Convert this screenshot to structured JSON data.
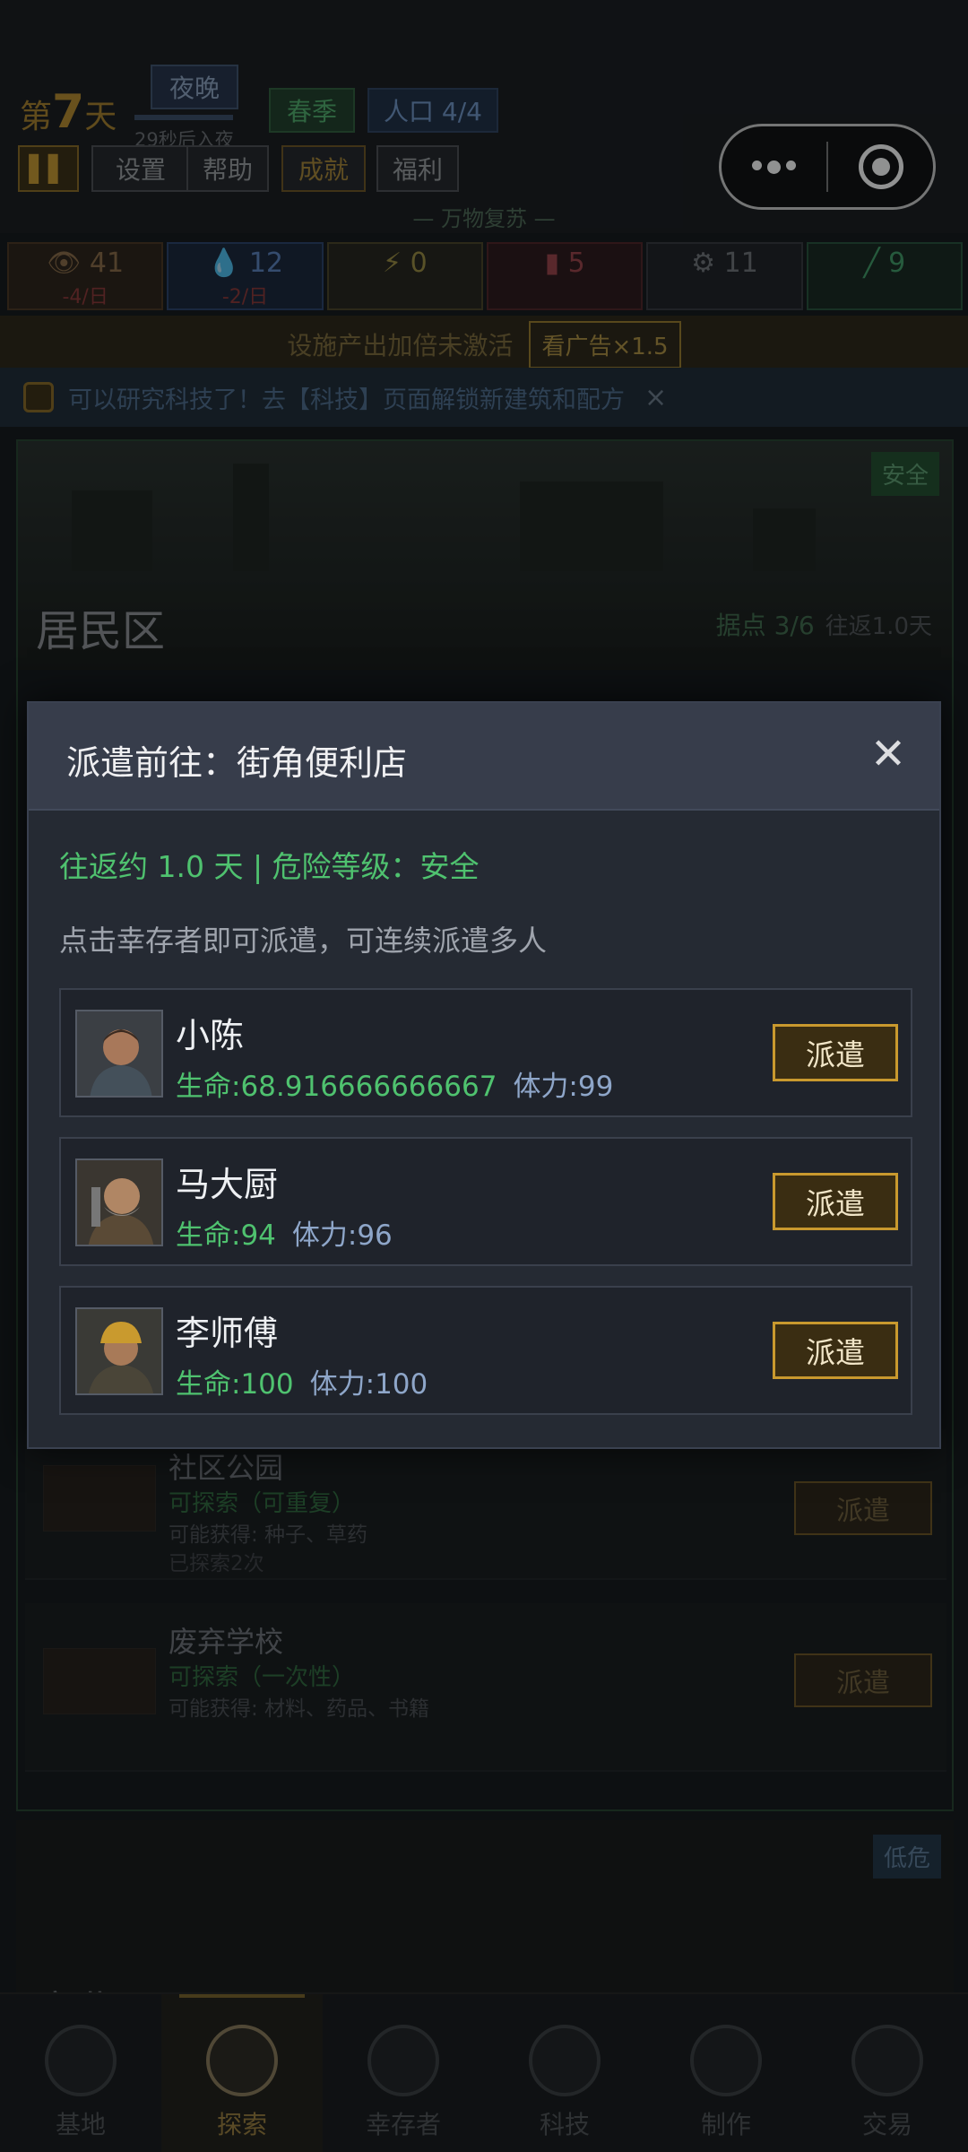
{
  "status": {
    "day_prefix": "第",
    "day_number": "7",
    "day_suffix": "天",
    "phase": "夜晚",
    "phase_countdown": "29秒后入夜",
    "season": "春季",
    "population": "人口 4/4",
    "motto": "— 万物复苏 —"
  },
  "top_buttons": {
    "pause_icon": "pause-icon",
    "settings": "设置",
    "help": "帮助",
    "achievements": "成就",
    "welfare": "福利"
  },
  "resources": [
    {
      "icon": "food-icon",
      "value": "41",
      "rate": "-4/日"
    },
    {
      "icon": "water-drop-icon",
      "value": "12",
      "rate": "-2/日"
    },
    {
      "icon": "energy-icon",
      "value": "0",
      "rate": ""
    },
    {
      "icon": "medicine-icon",
      "value": "5",
      "rate": ""
    },
    {
      "icon": "gear-icon",
      "value": "11",
      "rate": ""
    },
    {
      "icon": "pill-icon",
      "value": "9",
      "rate": ""
    }
  ],
  "ad_bar": {
    "text": "设施产出加倍未激活",
    "button": "看广告×1.5"
  },
  "tip": {
    "text": "可以研究科技了！去【科技】页面解锁新建筑和配方",
    "close": "×"
  },
  "zone": {
    "title": "居民区",
    "badge": "安全",
    "outposts": "据点 3/6",
    "travel": "往返1.0天",
    "locations": [
      {
        "name": "社区公园",
        "state": "可探索（可重复）",
        "loot": "可能获得: 种子、草药",
        "count": "已探索2次",
        "button": "派遣"
      },
      {
        "name": "废弃学校",
        "state": "可探索（一次性）",
        "loot": "可能获得: 材料、药品、书籍",
        "count": "",
        "button": "派遣"
      }
    ]
  },
  "next_zone": {
    "title": "商业区",
    "badge": "低危"
  },
  "tabs": [
    {
      "label": "基地",
      "icon": "base-icon"
    },
    {
      "label": "探索",
      "icon": "compass-icon"
    },
    {
      "label": "幸存者",
      "icon": "survivor-icon"
    },
    {
      "label": "科技",
      "icon": "tech-icon"
    },
    {
      "label": "制作",
      "icon": "craft-icon"
    },
    {
      "label": "交易",
      "icon": "trade-icon"
    }
  ],
  "active_tab": "探索",
  "modal": {
    "title": "派遣前往：街角便利店",
    "close": "✕",
    "info": "往返约 1.0 天 | 危险等级：安全",
    "hint": "点击幸存者即可派遣，可连续派遣多人",
    "survivors": [
      {
        "name": "小陈",
        "hp": "生命:68.916666666667",
        "stamina": "体力:99",
        "button": "派遣"
      },
      {
        "name": "马大厨",
        "hp": "生命:94",
        "stamina": "体力:96",
        "button": "派遣"
      },
      {
        "name": "李师傅",
        "hp": "生命:100",
        "stamina": "体力:100",
        "button": "派遣"
      }
    ]
  },
  "colors": {
    "accent_gold": "#c9992e",
    "safe_green": "#4fc26f",
    "stamina_blue": "#8ea6c9",
    "modal_bg": "#252a33"
  }
}
